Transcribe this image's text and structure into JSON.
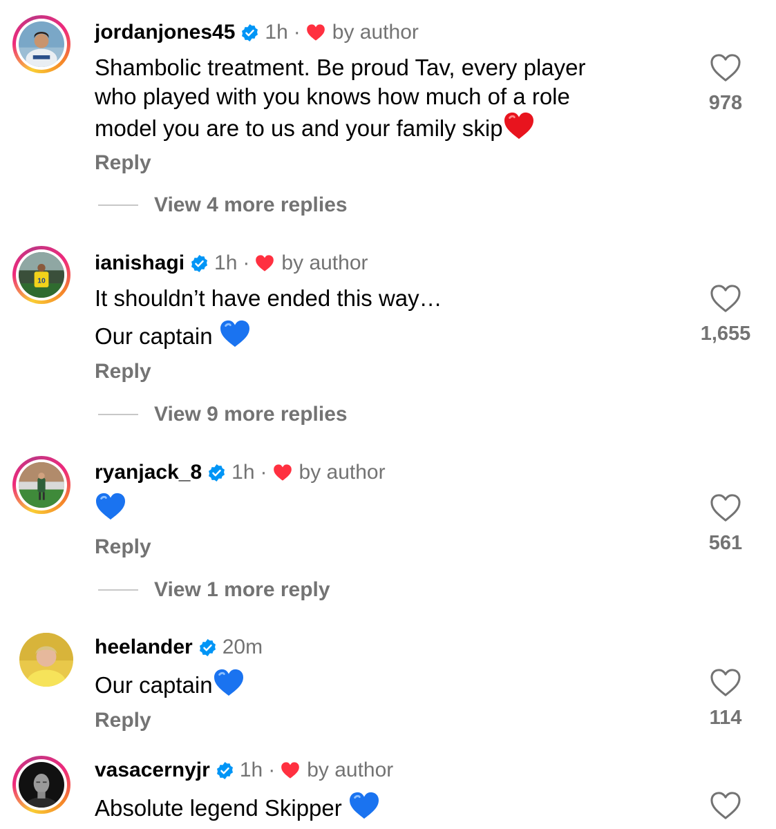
{
  "comments": [
    {
      "username": "jordanjones45",
      "time": "1h",
      "liked_by_author": "by author",
      "text_lines": [
        "Shambolic treatment. Be proud Tav, every player",
        "who played with you knows how much of a role",
        "model you are to us and your family skip"
      ],
      "emoji": "red-heart",
      "reply_label": "Reply",
      "view_more": "View 4 more replies",
      "likes": "978"
    },
    {
      "username": "ianishagi",
      "time": "1h",
      "liked_by_author": "by author",
      "text_lines": [
        "It shouldn’t have ended this way…",
        "Our captain"
      ],
      "emoji": "blue-heart",
      "reply_label": "Reply",
      "view_more": "View 9 more replies",
      "likes": "1,655"
    },
    {
      "username": "ryanjack_8",
      "time": "1h",
      "liked_by_author": "by author",
      "text_lines": [],
      "emoji": "blue-heart",
      "reply_label": "Reply",
      "view_more": "View 1 more reply",
      "likes": "561"
    },
    {
      "username": "heelander",
      "time": "20m",
      "text_lines": [
        "Our captain"
      ],
      "emoji": "blue-heart",
      "reply_label": "Reply",
      "likes": "114"
    },
    {
      "username": "vasacernyjr",
      "time": "1h",
      "liked_by_author": "by author",
      "text_lines": [
        "Absolute legend Skipper"
      ],
      "emoji": "blue-heart"
    }
  ],
  "colors": {
    "verified": "#0095f6",
    "secondary_text": "#737373",
    "heart_red": "#ff3040"
  }
}
